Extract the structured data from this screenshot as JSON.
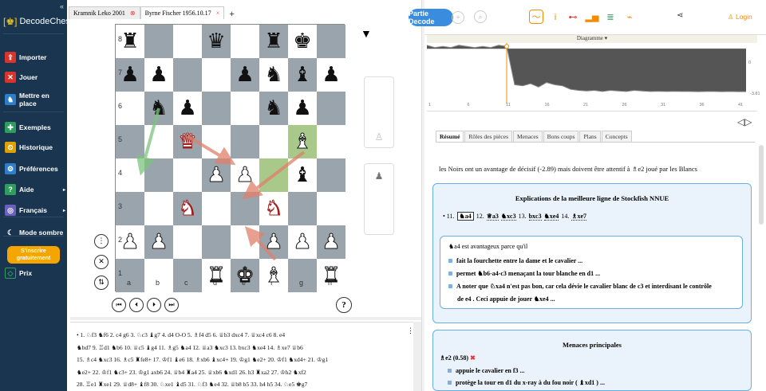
{
  "sidebar": {
    "logo": "DecodeChess",
    "items": [
      {
        "label": "Importer",
        "icon": "import-icon",
        "color": "#d9342b",
        "glyph": "⇪"
      },
      {
        "label": "Jouer",
        "icon": "play-icon",
        "color": "#d9342b",
        "glyph": "✕"
      },
      {
        "label": "Mettre en place",
        "icon": "setup-icon",
        "color": "#2f7fc8",
        "glyph": "♞"
      },
      {
        "label": "Exemples",
        "icon": "examples-icon",
        "color": "#2e9e5c",
        "glyph": "✚"
      },
      {
        "label": "Historique",
        "icon": "history-icon",
        "color": "#e0a000",
        "glyph": "⏲"
      },
      {
        "label": "Préférences",
        "icon": "settings-icon",
        "color": "#2f7fc8",
        "glyph": "⚙"
      },
      {
        "label": "Aide",
        "icon": "help-icon",
        "color": "#2e9e5c",
        "glyph": "?"
      },
      {
        "label": "Français",
        "icon": "language-icon",
        "color": "#6b5fc0",
        "glyph": "◎"
      },
      {
        "label": "Mode sombre",
        "icon": "dark-mode-icon",
        "color": "#1a3550",
        "glyph": "☾"
      }
    ],
    "signup": "S'inscrire gratuitement",
    "prix": "Prix"
  },
  "tabs": [
    {
      "label": "Kramnik Leko 2001",
      "active": false
    },
    {
      "label": "Byrne Fischer 1956.10.17",
      "active": true
    }
  ],
  "board": {
    "ranks": [
      "8",
      "7",
      "6",
      "5",
      "4",
      "3",
      "2",
      "1"
    ],
    "files": [
      "a",
      "b",
      "c",
      "d",
      "e",
      "f",
      "g",
      "h"
    ],
    "position": [
      [
        "",
        "",
        "",
        "",
        "",
        "",
        "",
        ""
      ],
      [
        "r",
        "",
        "",
        "q",
        "",
        "r",
        "k",
        ""
      ],
      [
        "p",
        "p",
        "",
        "",
        "p",
        "n",
        "b",
        "p"
      ],
      [
        "",
        "n",
        "p",
        "",
        "",
        "n",
        "p",
        ""
      ],
      [
        "",
        "",
        "Q",
        "",
        "",
        "",
        "B",
        ""
      ],
      [
        "",
        "",
        "",
        "P",
        "P",
        "",
        "b",
        ""
      ],
      [
        "",
        "",
        "N",
        "",
        "",
        "N",
        "",
        ""
      ],
      [
        "P",
        "P",
        "",
        "",
        "",
        "P",
        "P",
        "P"
      ],
      [
        "",
        "",
        "",
        "R",
        "K",
        "B",
        "",
        "R"
      ]
    ]
  },
  "moves": {
    "lines": [
      "• 1. ♘f3  ♞f6  2. c4  g6  3. ♘c3  ♝g7  4. d4  O-O  5. ♗f4  d5  6. ♕b3  dxc4  7. ♕xc4  c6  8. e4",
      "♞bd7  9. ♖d1  ♞b6  10. ♕c5  ♝g4  11. ♗g5  ♞a4  12. ♕a3  ♞xc3  13. bxc3  ♞xe4  14. ♗xe7  ♕b6",
      "15. ♗c4  ♞xc3  16. ♗c5  ♜fe8+  17. ♔f1  ♝e6  18. ♗xb6  ♝xc4+  19. ♔g1  ♞e2+  20. ♔f1  ♞xd4+  21. ♔g1",
      "♞e2+  22. ♔f1  ♞c3+  23. ♔g1  axb6  24. ♕b4  ♜a4  25. ♕xb6  ♞xd1  26. h3  ♜xa2  27. ♔h2  ♞xf2",
      "28. ♖e1  ♜xe1  29. ♕d8+  ♝f8  30. ♘xe1  ♝d5  31. ♘f3  ♞e4  32. ♕b8  b5  33. h4  h5  34. ♘e5  ♚g7"
    ]
  },
  "right": {
    "partie": "Partie Decode",
    "login": "Login",
    "diagram_title": "Diagramme ▾",
    "xticks": [
      "1",
      "6",
      "11",
      "16",
      "21",
      "26",
      "31",
      "36",
      "41"
    ],
    "ylabels": [
      "0",
      "-3.81"
    ],
    "eval": [
      0.3,
      0.1,
      0.2,
      0.1,
      0.3,
      0.2,
      0.1,
      0.2,
      0.1,
      0.3,
      0.2,
      -3.2,
      -3.3,
      -3.1,
      -3.4,
      -3.0,
      -3.2,
      -3.3,
      -3.6,
      -3.7,
      -3.75,
      -3.7,
      -3.8,
      -3.7,
      -3.75,
      -3.8,
      -3.7,
      -3.75,
      -3.8,
      -3.78,
      -3.8,
      -3.79,
      -3.8,
      -3.8,
      -3.81,
      -3.8,
      -3.8,
      -3.81,
      -3.8,
      -3.81,
      -3.81
    ],
    "ptabs": [
      "Résumé",
      "Rôles des pièces",
      "Menaces",
      "Bons coups",
      "Plans",
      "Concepts"
    ],
    "summary": "les Noirs ont un avantage de décisif (-2.89) mais doivent être attentif à ♗e2 joué par les Blancs",
    "card1_title": "Explications de la meilleure ligne de Stockfish NNUE",
    "line": [
      "• 11.",
      "♞a4",
      "12.",
      "♕a3",
      "♞xc3",
      "13.",
      "bxc3",
      "♞xe4",
      "14.",
      "♗xe7"
    ],
    "inner_head": "♞a4 est avantageux parce qu'il",
    "bullets": [
      "fait la fourchette entre la dame et le cavalier ...",
      "permet ♞b6-a4-c3 menaçant la tour blanche en d1 ...",
      "A noter que ♘xa4 n'est pas bon, car cela dévie le cavalier blanc de c3 et interdisant le contrôle",
      "de e4 . Ceci appuie de jouer ♞xe4 ..."
    ],
    "card2_title": "Menaces principales",
    "threat": "♗e2  (0.58)",
    "threat_bullets": [
      "appuie le cavalier en f3 ...",
      "protège la tour en d1 du x-ray à du fou noir ( ♝xd1 ) ..."
    ]
  }
}
